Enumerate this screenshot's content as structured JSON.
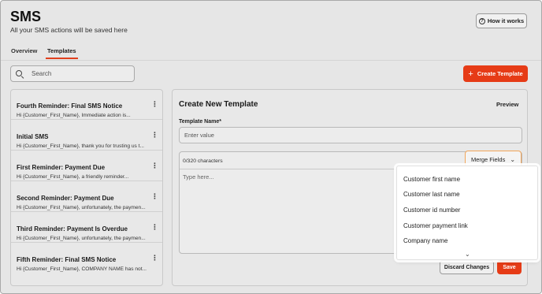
{
  "header": {
    "title": "SMS",
    "subtitle": "All your SMS actions will be saved here",
    "how_it_works_label": "How it works"
  },
  "tabs": [
    {
      "label": "Overview",
      "active": false
    },
    {
      "label": "Templates",
      "active": true
    }
  ],
  "search": {
    "placeholder": "Search",
    "value": ""
  },
  "create_template_label": "Create Template",
  "templates": [
    {
      "title": "Fourth Reminder: Final SMS Notice",
      "preview": "Hi {Customer_First_Name}, Immediate action is..."
    },
    {
      "title": "Initial SMS",
      "preview": "Hi {Customer_First_Name}, thank you for trusting us t..."
    },
    {
      "title": "First Reminder: Payment Due",
      "preview": "Hi {Customer_First_Name}, a friendly reminder..."
    },
    {
      "title": "Second Reminder: Payment Due",
      "preview": "Hi {Customer_First_Name}, unfortunately, the paymen..."
    },
    {
      "title": "Third Reminder: Payment Is Overdue",
      "preview": "Hi {Customer_First_Name}, unfortunately, the paymen..."
    },
    {
      "title": "Fifth Reminder: Final SMS Notice",
      "preview": "Hi {Customer_First_Name}, COMPANY NAME has not..."
    }
  ],
  "editor": {
    "title": "Create New Template",
    "preview_label": "Preview",
    "name_label": "Template Name*",
    "name_placeholder": "Enter value",
    "char_count": "0/320 characters",
    "message_placeholder": "Type here...",
    "merge_fields_label": "Merge Fields",
    "discard_label": "Discard Changes",
    "save_label": "Save"
  },
  "merge_fields": [
    "Customer first name",
    "Customer last name",
    "Customer id number",
    "Customer payment link",
    "Company name"
  ],
  "colors": {
    "accent": "#e63b16",
    "merge_focus_border": "#f2a65a"
  },
  "icons": {
    "help": "question-circle-icon",
    "search": "search-icon",
    "create": "plus-icon",
    "item_menu": "kebab-icon",
    "merge_dropdown": "chevron-down-icon",
    "more": "chevron-down-icon"
  }
}
